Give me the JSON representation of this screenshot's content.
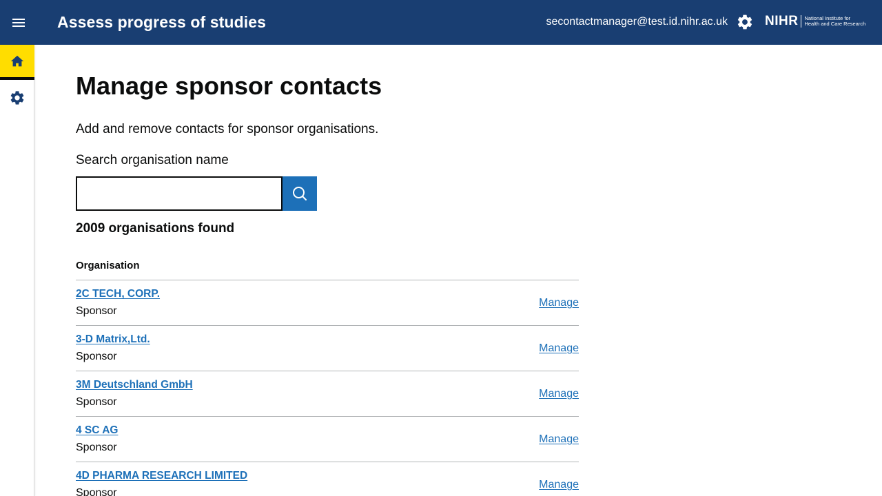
{
  "header": {
    "app_title": "Assess progress of studies",
    "user_email": "secontactmanager@test.id.nihr.ac.uk",
    "logo_main": "NIHR",
    "logo_line1": "National Institute for",
    "logo_line2": "Health and Care Research",
    "icons": {
      "menu": "hamburger-menu-icon",
      "settings": "gear-icon"
    },
    "color": "#193e72"
  },
  "sidebar": {
    "items": [
      {
        "icon": "home-icon",
        "active": true
      },
      {
        "icon": "gear-icon",
        "active": false
      }
    ],
    "active_color": "#ffdd00"
  },
  "main": {
    "title": "Manage sponsor contacts",
    "lead": "Add and remove contacts for sponsor organisations.",
    "search": {
      "label": "Search organisation name",
      "value": "",
      "button_icon": "search-icon"
    },
    "results_count": "2009 organisations found",
    "table": {
      "header": "Organisation",
      "rows": [
        {
          "name": "2C TECH, CORP.",
          "type": "Sponsor",
          "action": "Manage"
        },
        {
          "name": "3-D Matrix,Ltd.",
          "type": "Sponsor",
          "action": "Manage"
        },
        {
          "name": "3M Deutschland GmbH",
          "type": "Sponsor",
          "action": "Manage"
        },
        {
          "name": "4 SC AG",
          "type": "Sponsor",
          "action": "Manage"
        },
        {
          "name": "4D PHARMA RESEARCH LIMITED",
          "type": "Sponsor",
          "action": "Manage"
        }
      ]
    },
    "link_color": "#1d70b8"
  }
}
